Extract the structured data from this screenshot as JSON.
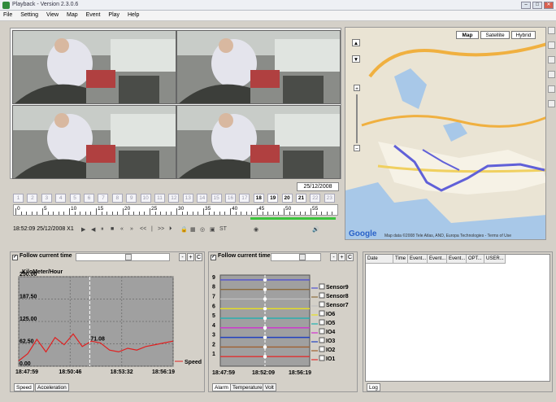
{
  "window": {
    "title": "Playback - Version 2.3.0.6",
    "min": "–",
    "max": "□",
    "close": "✕"
  },
  "menu": [
    "File",
    "Setting",
    "View",
    "Map",
    "Event",
    "Play",
    "Help"
  ],
  "video": {
    "date": "25/12/2008"
  },
  "days": [
    "1",
    "2",
    "3",
    "4",
    "5",
    "6",
    "7",
    "8",
    "9",
    "10",
    "11",
    "12",
    "13",
    "14",
    "15",
    "16",
    "17",
    "18",
    "19",
    "20",
    "21",
    "22",
    "23"
  ],
  "active_days": [
    "18",
    "19",
    "20",
    "21"
  ],
  "hour_labels": [
    "0",
    "5",
    "10",
    "15",
    "20",
    "25",
    "30",
    "35",
    "40",
    "45",
    "50",
    "55"
  ],
  "playback": {
    "current_time": "18:52:09 25/12/2008 X1",
    "controls": [
      "▶",
      "◀",
      "⏸",
      "■",
      "«",
      "»",
      "<<",
      "|",
      ">>",
      "⏵",
      "ST"
    ]
  },
  "map": {
    "types": [
      "Map",
      "Satellite",
      "Hybrid"
    ],
    "copyright": "Map data ©2008 Tele Atlas, AND, Europa Technologies - Terms of Use",
    "logo": "Google",
    "pan_up": "▲",
    "pan_down": "▼",
    "zoom_in": "+",
    "zoom_out": "−"
  },
  "speed_panel": {
    "follow_label": "Follow current time",
    "unit_label": "KiloMeter/Hour",
    "y_ticks": [
      "250.00",
      "187.50",
      "125.00",
      "62.50",
      "0.00"
    ],
    "x_ticks": [
      "18:47:59",
      "18:50:46",
      "18:53:32",
      "18:56:19"
    ],
    "legend": "Speed",
    "cursor_value": "71.08",
    "tabs": [
      "Speed",
      "Acceleration"
    ],
    "zoom_buttons": [
      "-",
      "+",
      "C"
    ]
  },
  "io_panel": {
    "follow_label": "Follow current time",
    "y_ticks": [
      "9",
      "8",
      "7",
      "6",
      "5",
      "4",
      "3",
      "2",
      "1"
    ],
    "x_ticks": [
      "18:47:59",
      "18:52:09",
      "18:56:19"
    ],
    "legend": [
      "Sensor9",
      "Sensor8",
      "Sensor7",
      "IO6",
      "IO5",
      "IO4",
      "IO3",
      "IO2",
      "IO1"
    ],
    "tabs": [
      "Alarm",
      "Temperature",
      "Volt"
    ],
    "zoom_buttons": [
      "-",
      "+",
      "C"
    ]
  },
  "log_panel": {
    "columns": [
      "Date",
      "Time",
      "Event...",
      "Event...",
      "Event...",
      "OPT...",
      "USER..."
    ],
    "tabs": [
      "Log"
    ]
  },
  "colors": {
    "speed_line": "#e02020",
    "sensor9": "#5050d0",
    "sensor8": "#8b6b3d",
    "sensor7": "#c0c0c0",
    "io6": "#e8e020",
    "io5": "#20b0b0",
    "io4": "#d030d0",
    "io3": "#2040c0",
    "io2": "#a06030",
    "io1": "#e03030"
  },
  "chart_data": [
    {
      "type": "line",
      "ylabel": "KiloMeter/Hour",
      "ylim": [
        0,
        250
      ],
      "x": [
        "18:47:59",
        "18:48:30",
        "18:49:00",
        "18:49:30",
        "18:50:00",
        "18:50:30",
        "18:51:00",
        "18:51:30",
        "18:52:00",
        "18:52:30",
        "18:53:00",
        "18:53:30",
        "18:54:00",
        "18:54:30",
        "18:55:00",
        "18:55:30",
        "18:56:00",
        "18:56:19"
      ],
      "series": [
        {
          "name": "Speed",
          "values": [
            15,
            35,
            75,
            40,
            80,
            60,
            90,
            55,
            70,
            65,
            45,
            40,
            50,
            45,
            55,
            60,
            65,
            70
          ]
        }
      ]
    },
    {
      "type": "line",
      "ylim": [
        0,
        9.5
      ],
      "x": [
        "18:47:59",
        "18:52:09",
        "18:56:19"
      ],
      "series": [
        {
          "name": "IO1",
          "values": [
            1,
            1,
            1
          ]
        },
        {
          "name": "IO2",
          "values": [
            2,
            2,
            2
          ]
        },
        {
          "name": "IO3",
          "values": [
            3,
            3,
            3
          ]
        },
        {
          "name": "IO4",
          "values": [
            4,
            4,
            4
          ]
        },
        {
          "name": "IO5",
          "values": [
            5,
            5,
            5
          ]
        },
        {
          "name": "IO6",
          "values": [
            6,
            6,
            6
          ]
        },
        {
          "name": "Sensor7",
          "values": [
            7,
            7,
            7
          ]
        },
        {
          "name": "Sensor8",
          "values": [
            8,
            8,
            8
          ]
        },
        {
          "name": "Sensor9",
          "values": [
            9,
            9,
            9
          ]
        }
      ]
    }
  ]
}
